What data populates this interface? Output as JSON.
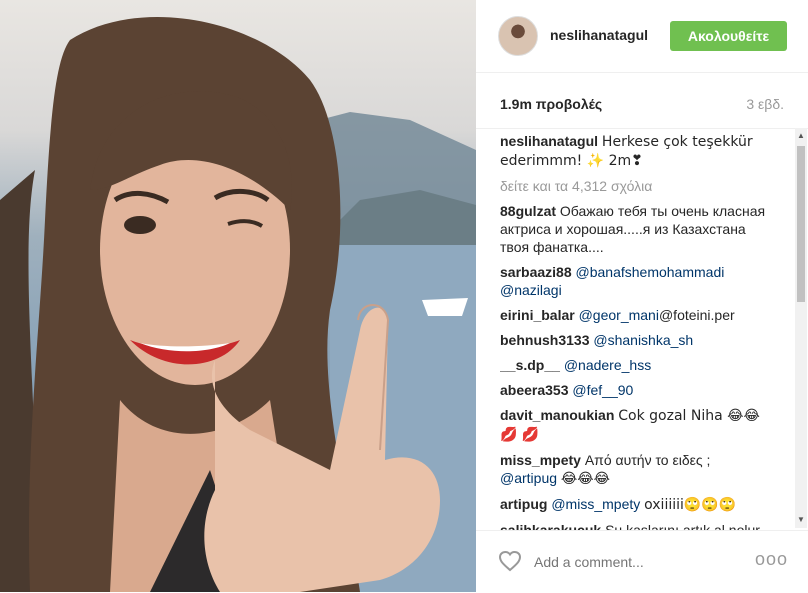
{
  "post": {
    "username": "neslihanatagul",
    "follow_label": "Ακολουθείτε",
    "views": "1.9m προβολές",
    "age": "3 εβδ.",
    "caption_user": "neslihanatagul",
    "caption_text": "Herkese çok teşekkür ederimmm! ✨ 2m❣",
    "more_comments": "δείτε και τα 4,312 σχόλια",
    "comments": [
      {
        "user": "88gulzat",
        "text": "Обажаю тебя ты очень класная актриса и хорошая.....я из Казахстана твоя фанатка....",
        "mention": ""
      },
      {
        "user": "sarbaazi88",
        "text": "",
        "mention": "@banafshemohammadi @nazilagi"
      },
      {
        "user": "eirini_balar",
        "mention": "@geor_mani",
        "text": "@foteini.per"
      },
      {
        "user": "behnush3133",
        "mention": "@shanishka_sh",
        "text": ""
      },
      {
        "user": "__s.dp__",
        "mention": "@nadere_hss",
        "text": ""
      },
      {
        "user": "abeera353",
        "mention": "@fef__90",
        "text": ""
      },
      {
        "user": "davit_manoukian",
        "mention": "",
        "text": "Cok gozal Niha 😂😂💋 💋"
      },
      {
        "user": "miss_mpety",
        "text": "Από αυτήν το ειδες ;",
        "mention": "@artipug",
        "text2": "😂😂😂"
      },
      {
        "user": "artipug",
        "mention": "@miss_mpety",
        "text": "oxiiiiii🙄🙄🙄"
      },
      {
        "user": "salihkarakucuk",
        "text": "Su kaşlarını artık al nolur",
        "mention": ""
      }
    ],
    "add_comment_placeholder": "Add a comment...",
    "more_options": "ooo"
  },
  "icons": {
    "heart": "heart-icon",
    "more": "more-options-icon",
    "scroll_up": "scroll-up-icon",
    "scroll_down": "scroll-down-icon"
  },
  "colors": {
    "follow_button": "#70c050",
    "mention": "#003569",
    "muted": "#999999"
  }
}
